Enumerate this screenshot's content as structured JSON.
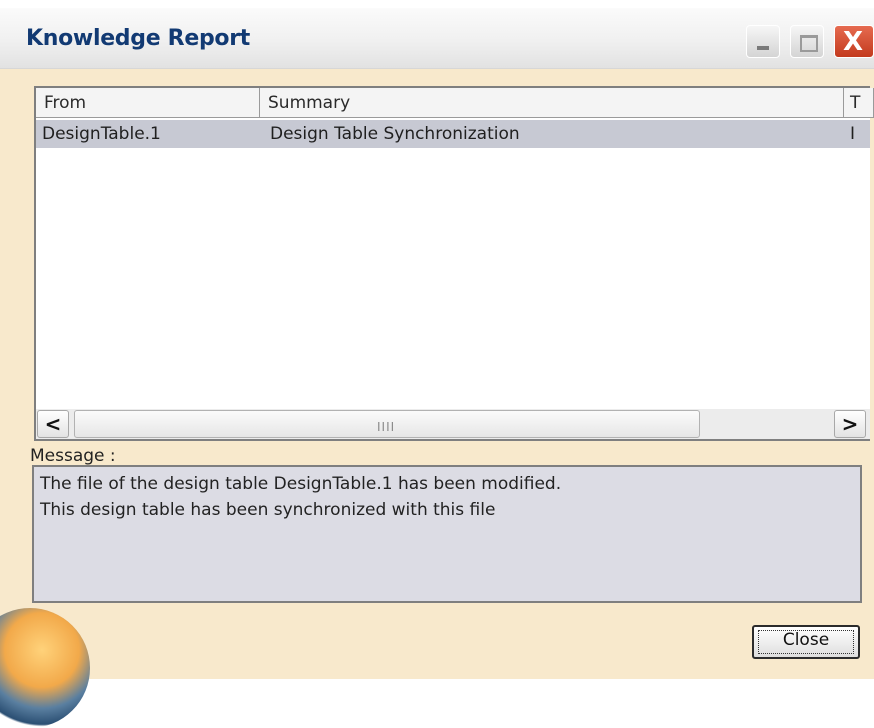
{
  "window": {
    "title": "Knowledge Report",
    "buttons": {
      "minimize": "minimize",
      "maximize": "maximize",
      "close": "X"
    }
  },
  "table": {
    "columns": [
      "From",
      "Summary",
      "T"
    ],
    "rows": [
      {
        "from": "DesignTable.1",
        "summary": "Design Table Synchronization",
        "extra": "I"
      }
    ]
  },
  "scrollbar": {
    "left_arrow": "<",
    "right_arrow": ">",
    "grip": "IIII"
  },
  "message": {
    "label": "Message :",
    "lines": [
      "The file of the design table DesignTable.1 has been modified.",
      "This design table has been synchronized with this file"
    ]
  },
  "footer": {
    "close_label": "Close"
  },
  "colors": {
    "window_bg": "#f8e9cc",
    "title_text": "#123a73",
    "selected_row": "#c7c9d3",
    "close_button_red": "#d9482b"
  }
}
